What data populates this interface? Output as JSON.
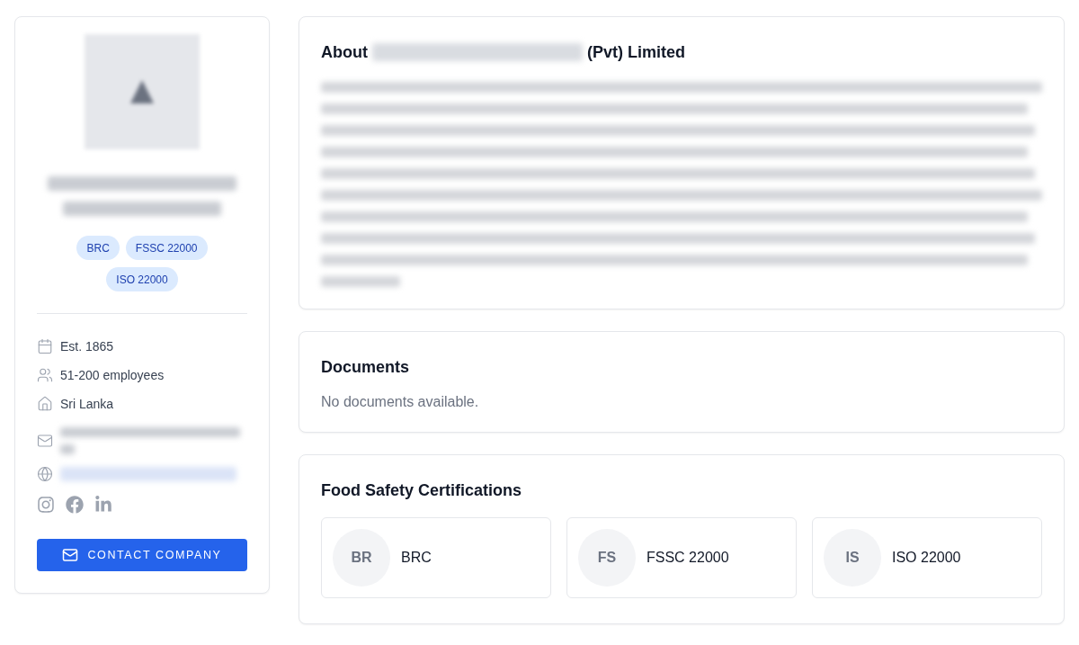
{
  "company_card": {
    "badges": [
      "BRC",
      "FSSC 22000",
      "ISO 22000"
    ],
    "details": [
      {
        "kind": "founded",
        "text": "Est. 1865"
      },
      {
        "kind": "employees",
        "text": "51-200 employees"
      },
      {
        "kind": "location",
        "text": "Sri Lanka"
      }
    ],
    "contact_rows": [
      {
        "kind": "email"
      },
      {
        "kind": "website"
      }
    ],
    "social_links": [
      {
        "kind": "instagram"
      },
      {
        "kind": "facebook"
      },
      {
        "kind": "linkedin"
      }
    ],
    "contact_button": "CONTACT COMPANY"
  },
  "about": {
    "title_prefix": "About",
    "title_suffix": "(Pvt) Limited"
  },
  "documents": {
    "title": "Documents",
    "empty_message": "No documents available."
  },
  "certifications": {
    "title": "Food Safety Certifications",
    "items": [
      {
        "initials": "BR",
        "name": "BRC"
      },
      {
        "initials": "FS",
        "name": "FSSC 22000"
      },
      {
        "initials": "IS",
        "name": "ISO 22000"
      }
    ]
  }
}
